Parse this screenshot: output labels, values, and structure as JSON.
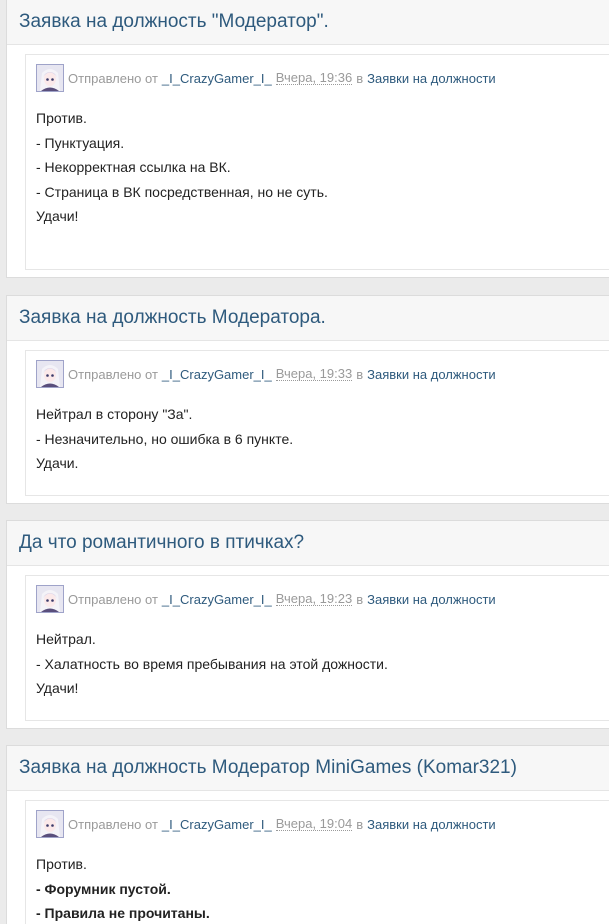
{
  "posts": [
    {
      "title": "Заявка на должность \"Модератор\".",
      "meta": {
        "sent_label": "Отправлено от",
        "author": "_I_CrazyGamer_I_",
        "time": "Вчера, 19:36",
        "in_label": "в",
        "forum": "Заявки на должности"
      },
      "lines": [
        {
          "text": "Против.",
          "bold": false
        },
        {
          "text": "- Пунктуация.",
          "bold": false
        },
        {
          "text": "- Некорректная ссылка на ВК.",
          "bold": false
        },
        {
          "text": "- Страница в ВК посредственная, но не суть.",
          "bold": false
        },
        {
          "text": "Удачи!",
          "bold": false
        }
      ]
    },
    {
      "title": "Заявка на должность Модератора.",
      "meta": {
        "sent_label": "Отправлено от",
        "author": "_I_CrazyGamer_I_",
        "time": "Вчера, 19:33",
        "in_label": "в",
        "forum": "Заявки на должности"
      },
      "lines": [
        {
          "text": "Нейтрал в сторону \"За\".",
          "bold": false
        },
        {
          "text": "- Незначительно, но ошибка в 6 пункте.",
          "bold": false
        },
        {
          "text": "Удачи.",
          "bold": false
        }
      ]
    },
    {
      "title": "Да что романтичного в птичках?",
      "meta": {
        "sent_label": "Отправлено от",
        "author": "_I_CrazyGamer_I_",
        "time": "Вчера, 19:23",
        "in_label": "в",
        "forum": "Заявки на должности"
      },
      "lines": [
        {
          "text": "Нейтрал.",
          "bold": false
        },
        {
          "text": "- Халатность во время пребывания на этой дожности.",
          "bold": false
        },
        {
          "text": "Удачи!",
          "bold": false
        }
      ]
    },
    {
      "title": "Заявка на должность Модератор MiniGames (Komar321)",
      "meta": {
        "sent_label": "Отправлено от",
        "author": "_I_CrazyGamer_I_",
        "time": "Вчера, 19:04",
        "in_label": "в",
        "forum": "Заявки на должности"
      },
      "lines": [
        {
          "text": "Против.",
          "bold": false
        },
        {
          "text": "- Форумник пустой.",
          "bold": true
        },
        {
          "text": "- Правила не прочитаны.",
          "bold": true
        }
      ]
    }
  ]
}
